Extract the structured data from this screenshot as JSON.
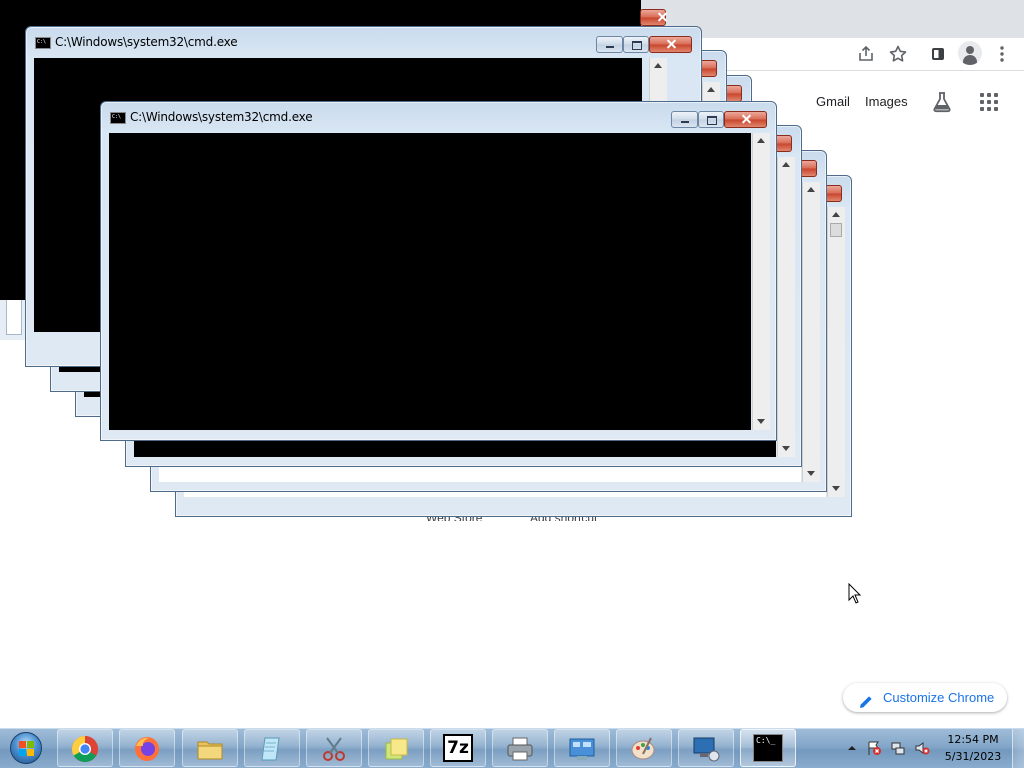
{
  "chrome": {
    "gmail": "Gmail",
    "images": "Images",
    "web_store": "Web Store",
    "add_shortcut": "Add shortcut",
    "customize": "Customize Chrome"
  },
  "cmd_windows": {
    "title": "C:\\Windows\\system32\\cmd.exe"
  },
  "taskbar": {
    "apps": [
      "chrome-icon",
      "firefox-icon",
      "file-explorer-icon",
      "notepad-icon",
      "snipping-tool-icon",
      "sticky-notes-icon",
      "7zip-icon",
      "printer-icon",
      "control-panel-icon",
      "paint-icon",
      "remote-desktop-icon",
      "cmd-icon"
    ],
    "seven_zip_label": "7z",
    "cmd_label": "C:\\_",
    "clock_time": "12:54 PM",
    "clock_date": "5/31/2023"
  },
  "colors": {
    "chrome_accent": "#1a73e8",
    "console_bg": "#000000",
    "close_button": "#c8432b",
    "taskbar": "#83a6c8"
  }
}
